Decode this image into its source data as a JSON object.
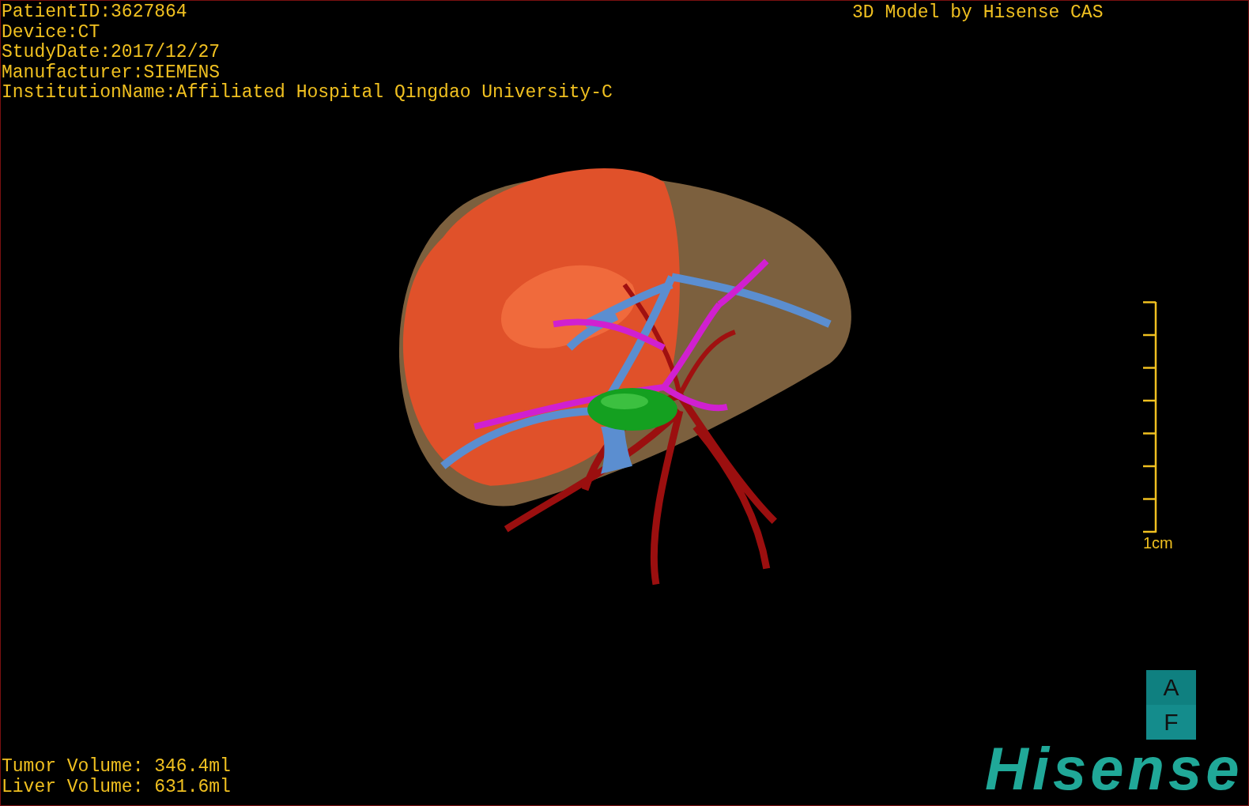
{
  "info": [
    "PatientID:3627864",
    "Device:CT",
    "StudyDate:2017/12/27",
    "Manufacturer:SIEMENS",
    "InstitutionName:Affiliated Hospital Qingdao University-C"
  ],
  "title": "3D Model by Hisense CAS",
  "scale_bar": {
    "label": "1cm"
  },
  "orientation": [
    "A",
    "F"
  ],
  "volumes": [
    "Tumor Volume: 346.4ml",
    "Liver Volume: 631.6ml"
  ],
  "logo": "Hisense"
}
